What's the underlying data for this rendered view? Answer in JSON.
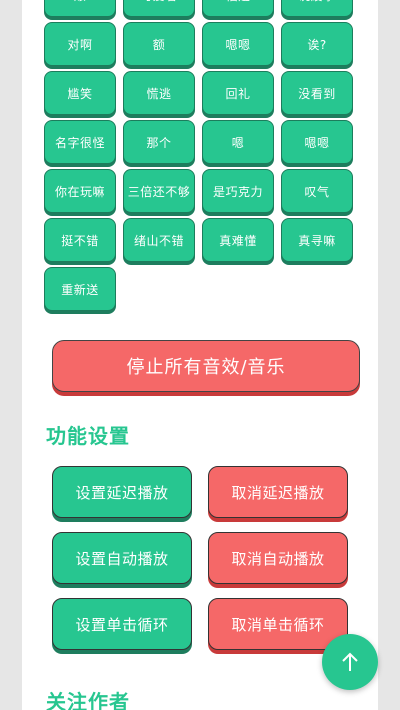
{
  "sound_buttons": [
    {
      "label": "账"
    },
    {
      "label": "可爱者"
    },
    {
      "label": "福建"
    },
    {
      "label": "说废事"
    },
    {
      "label": "对啊"
    },
    {
      "label": "额"
    },
    {
      "label": "嗯嗯"
    },
    {
      "label": "诶?"
    },
    {
      "label": "尴笑"
    },
    {
      "label": "慌逃"
    },
    {
      "label": "回礼"
    },
    {
      "label": "没看到"
    },
    {
      "label": "名字很怪"
    },
    {
      "label": "那个"
    },
    {
      "label": "嗯"
    },
    {
      "label": "嗯嗯"
    },
    {
      "label": "你在玩嘛"
    },
    {
      "label": "三倍还不够"
    },
    {
      "label": "是巧克力"
    },
    {
      "label": "叹气"
    },
    {
      "label": "挺不错"
    },
    {
      "label": "绪山不错"
    },
    {
      "label": "真难懂"
    },
    {
      "label": "真寻嘛"
    },
    {
      "label": "重新送"
    }
  ],
  "stop_button": {
    "label": "停止所有音效/音乐"
  },
  "function_settings": {
    "title": "功能设置",
    "set_delay": "设置延迟播放",
    "cancel_delay": "取消延迟播放",
    "set_auto": "设置自动播放",
    "cancel_auto": "取消自动播放",
    "set_loop": "设置单击循环",
    "cancel_loop": "取消单击循环"
  },
  "follow_author": {
    "title": "关注作者"
  },
  "colors": {
    "primary": "#27c690",
    "danger": "#f56868",
    "background": "#e6e6e6"
  },
  "icons": {
    "scroll_top": "arrow-up-icon"
  }
}
